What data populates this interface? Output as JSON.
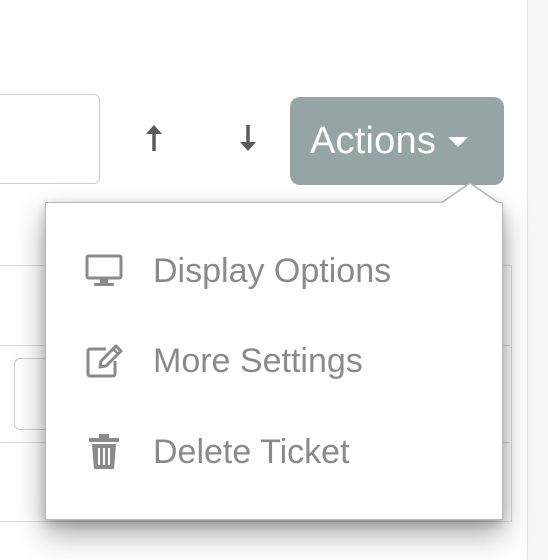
{
  "toolbar": {
    "move_up_icon": "arrow-up-icon",
    "move_down_icon": "arrow-down-icon",
    "actions_label": "Actions",
    "actions_color": "#95a5a6"
  },
  "dropdown": {
    "items": [
      {
        "label": "Display Options",
        "icon": "monitor-icon"
      },
      {
        "label": "More Settings",
        "icon": "edit-icon"
      },
      {
        "label": "Delete Ticket",
        "icon": "trash-icon"
      }
    ]
  }
}
